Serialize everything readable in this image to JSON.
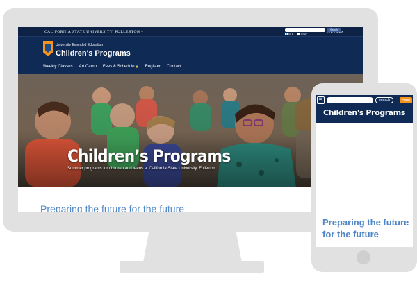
{
  "desktop": {
    "utility_bar": {
      "university": "CALIFORNIA STATE UNIVERSITY, FULLERTON",
      "dropdown_caret": "▾",
      "az_index": "A-Z INDEX",
      "search_button": "Search",
      "scope_options": [
        "SITE",
        "CSUF"
      ],
      "selected_scope": "SITE"
    },
    "header": {
      "department": "University Extended Education",
      "site_name": "Children's Programs"
    },
    "nav": {
      "items": [
        "Weekly Classes",
        "Art Camp",
        "Fees & Schedule",
        "Register",
        "Contact"
      ],
      "lock_icon_after": "Fees & Schedule"
    },
    "hero": {
      "title": "Children’s Programs",
      "subtitle": "Summer programs for children and teens at California State University, Fullerton"
    },
    "main": {
      "heading": "Preparing the future for the future"
    }
  },
  "mobile": {
    "menu_glyph": "☰",
    "search_button": "search",
    "csuf_badge": "CSUF",
    "site_title": "Children's Programs",
    "heading": "Preparing the future for the future"
  },
  "colors": {
    "navy": "#0f2a55",
    "utility_navy": "#0d2244",
    "accent_orange": "#f7941d",
    "heading_blue": "#4f86c6",
    "device_gray": "#e1e1e1"
  },
  "icons": {
    "caret": "chevron-down-icon",
    "lock": "lock-icon",
    "menu": "hamburger-menu-icon",
    "logo": "titan-shield-logo-icon",
    "home_button": "home-button"
  }
}
